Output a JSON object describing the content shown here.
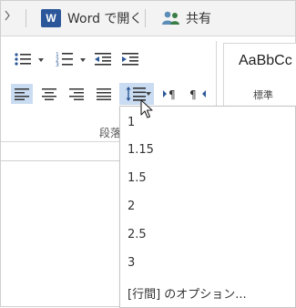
{
  "toolbar": {
    "word_icon_letter": "W",
    "open_in_word_label": "Word で開く",
    "share_label": "共有"
  },
  "paragraph_group": {
    "label": "段落"
  },
  "styles": {
    "sample": "AaBbCc",
    "name": "標準"
  },
  "line_spacing_menu": {
    "options": [
      "1",
      "1.15",
      "1.5",
      "2",
      "2.5",
      "3"
    ],
    "more_options": "[行間] のオプション..."
  },
  "colors": {
    "word_blue": "#2b579a",
    "active_highlight": "#c9dcf2",
    "icon_blue": "#2b5797"
  }
}
